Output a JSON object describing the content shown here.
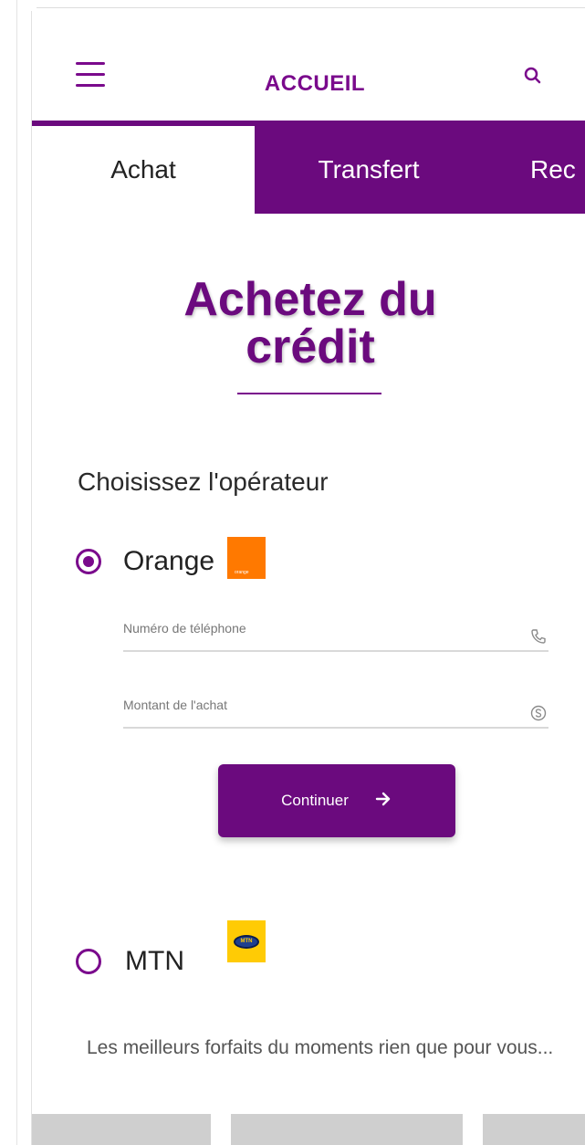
{
  "header": {
    "title": "ACCUEIL",
    "menu_icon": "hamburger-menu-icon",
    "search_icon": "search-icon"
  },
  "tabs": [
    {
      "label": "Achat",
      "active": true
    },
    {
      "label": "Transfert",
      "active": false
    },
    {
      "label": "Rec",
      "active": false
    }
  ],
  "main": {
    "heading_line1": "Achetez du",
    "heading_line2": "crédit",
    "operator_prompt": "Choisissez l'opérateur",
    "operators": [
      {
        "label": "Orange",
        "selected": true,
        "logo": "orange-logo-icon",
        "logo_text": "orange",
        "color": "#ff7900"
      },
      {
        "label": "MTN",
        "selected": false,
        "logo": "mtn-logo-icon",
        "logo_text": "MTN",
        "color": "#ffcb05"
      }
    ],
    "fields": {
      "phone_placeholder": "Numéro de téléphone",
      "phone_icon": "phone-icon",
      "amount_placeholder": "Montant de l'achat",
      "amount_icon": "currency-icon"
    },
    "continue_label": "Continuer",
    "continue_icon": "arrow-right-icon",
    "promo_text": "Les meilleurs forfaits du moments rien que pour vous..."
  },
  "colors": {
    "accent": "#6b0a7e",
    "accent_light": "#7a0a8c",
    "orange_brand": "#ff7900",
    "mtn_brand": "#ffcb05"
  }
}
